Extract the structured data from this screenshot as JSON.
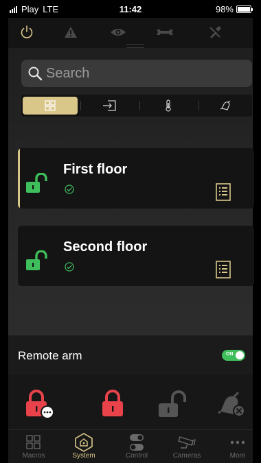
{
  "status_bar": {
    "carrier": "Play",
    "network": "LTE",
    "time": "11:42",
    "battery": "98%",
    "battery_level": 0.98
  },
  "top_tabs": [
    {
      "icon": "power-icon",
      "active": true
    },
    {
      "icon": "warning-icon",
      "active": false
    },
    {
      "icon": "eye-icon",
      "active": false
    },
    {
      "icon": "wrench-icon",
      "active": false
    },
    {
      "icon": "tools-icon",
      "active": false
    }
  ],
  "search": {
    "placeholder": "Search",
    "value": ""
  },
  "filters": [
    {
      "icon": "partitions-icon",
      "active": true
    },
    {
      "icon": "outputs-icon",
      "active": false
    },
    {
      "icon": "thermometer-icon",
      "active": false
    },
    {
      "icon": "bell-icon",
      "active": false
    }
  ],
  "partitions": [
    {
      "name": "First floor",
      "status": "ok",
      "lock_state": "unlocked",
      "selected": true
    },
    {
      "name": "Second floor",
      "status": "ok",
      "lock_state": "unlocked",
      "selected": false
    }
  ],
  "remote_arm": {
    "label": "Remote arm",
    "toggle_text": "ON",
    "enabled": true
  },
  "actions": [
    {
      "icon": "arm-menu-icon"
    },
    {
      "icon": "arm-icon"
    },
    {
      "icon": "disarm-icon"
    },
    {
      "icon": "clear-alarm-icon"
    }
  ],
  "bottom_nav": [
    {
      "label": "Macros",
      "icon": "macros-icon",
      "active": false
    },
    {
      "label": "System",
      "icon": "system-icon",
      "active": true
    },
    {
      "label": "Control",
      "icon": "control-icon",
      "active": false
    },
    {
      "label": "Cameras",
      "icon": "camera-icon",
      "active": false
    },
    {
      "label": "More",
      "icon": "more-icon",
      "active": false
    }
  ],
  "colors": {
    "accent": "#d9c78a",
    "armed_red": "#e8434a",
    "unlocked_green": "#3fbf5c",
    "panel": "#141414",
    "inactive_icon": "#555555"
  }
}
